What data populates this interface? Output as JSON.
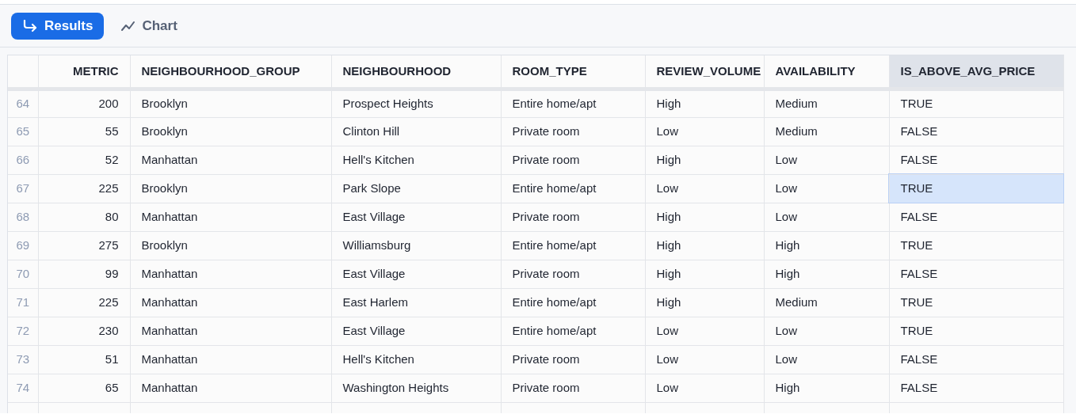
{
  "tabs": [
    {
      "label": "Results",
      "kind": "results",
      "selected": true
    },
    {
      "label": "Chart",
      "kind": "chart",
      "selected": false
    }
  ],
  "table": {
    "columns": [
      {
        "label": "METRIC",
        "numeric": true,
        "selected": false
      },
      {
        "label": "NEIGHBOURHOOD_GROUP",
        "numeric": false,
        "selected": false
      },
      {
        "label": "NEIGHBOURHOOD",
        "numeric": false,
        "selected": false
      },
      {
        "label": "ROOM_TYPE",
        "numeric": false,
        "selected": false
      },
      {
        "label": "REVIEW_VOLUME",
        "numeric": false,
        "selected": false
      },
      {
        "label": "AVAILABILITY",
        "numeric": false,
        "selected": false
      },
      {
        "label": "IS_ABOVE_AVG_PRICE",
        "numeric": false,
        "selected": true
      }
    ],
    "rows": [
      {
        "number": "64",
        "cells": [
          {
            "text": "200",
            "selected": false
          },
          {
            "text": "Brooklyn",
            "selected": false
          },
          {
            "text": "Prospect Heights",
            "selected": false
          },
          {
            "text": "Entire home/apt",
            "selected": false
          },
          {
            "text": "High",
            "selected": false
          },
          {
            "text": "Medium",
            "selected": false
          },
          {
            "text": "TRUE",
            "selected": false
          }
        ]
      },
      {
        "number": "65",
        "cells": [
          {
            "text": "55",
            "selected": false
          },
          {
            "text": "Brooklyn",
            "selected": false
          },
          {
            "text": "Clinton Hill",
            "selected": false
          },
          {
            "text": "Private room",
            "selected": false
          },
          {
            "text": "Low",
            "selected": false
          },
          {
            "text": "Medium",
            "selected": false
          },
          {
            "text": "FALSE",
            "selected": false
          }
        ]
      },
      {
        "number": "66",
        "cells": [
          {
            "text": "52",
            "selected": false
          },
          {
            "text": "Manhattan",
            "selected": false
          },
          {
            "text": "Hell's Kitchen",
            "selected": false
          },
          {
            "text": "Private room",
            "selected": false
          },
          {
            "text": "High",
            "selected": false
          },
          {
            "text": "Low",
            "selected": false
          },
          {
            "text": "FALSE",
            "selected": false
          }
        ]
      },
      {
        "number": "67",
        "cells": [
          {
            "text": "225",
            "selected": false
          },
          {
            "text": "Brooklyn",
            "selected": false
          },
          {
            "text": "Park Slope",
            "selected": false
          },
          {
            "text": "Entire home/apt",
            "selected": false
          },
          {
            "text": "Low",
            "selected": false
          },
          {
            "text": "Low",
            "selected": false
          },
          {
            "text": "TRUE",
            "selected": true
          }
        ]
      },
      {
        "number": "68",
        "cells": [
          {
            "text": "80",
            "selected": false
          },
          {
            "text": "Manhattan",
            "selected": false
          },
          {
            "text": "East Village",
            "selected": false
          },
          {
            "text": "Private room",
            "selected": false
          },
          {
            "text": "High",
            "selected": false
          },
          {
            "text": "Low",
            "selected": false
          },
          {
            "text": "FALSE",
            "selected": false
          }
        ]
      },
      {
        "number": "69",
        "cells": [
          {
            "text": "275",
            "selected": false
          },
          {
            "text": "Brooklyn",
            "selected": false
          },
          {
            "text": "Williamsburg",
            "selected": false
          },
          {
            "text": "Entire home/apt",
            "selected": false
          },
          {
            "text": "High",
            "selected": false
          },
          {
            "text": "High",
            "selected": false
          },
          {
            "text": "TRUE",
            "selected": false
          }
        ]
      },
      {
        "number": "70",
        "cells": [
          {
            "text": "99",
            "selected": false
          },
          {
            "text": "Manhattan",
            "selected": false
          },
          {
            "text": "East Village",
            "selected": false
          },
          {
            "text": "Private room",
            "selected": false
          },
          {
            "text": "High",
            "selected": false
          },
          {
            "text": "High",
            "selected": false
          },
          {
            "text": "FALSE",
            "selected": false
          }
        ]
      },
      {
        "number": "71",
        "cells": [
          {
            "text": "225",
            "selected": false
          },
          {
            "text": "Manhattan",
            "selected": false
          },
          {
            "text": "East Harlem",
            "selected": false
          },
          {
            "text": "Entire home/apt",
            "selected": false
          },
          {
            "text": "High",
            "selected": false
          },
          {
            "text": "Medium",
            "selected": false
          },
          {
            "text": "TRUE",
            "selected": false
          }
        ]
      },
      {
        "number": "72",
        "cells": [
          {
            "text": "230",
            "selected": false
          },
          {
            "text": "Manhattan",
            "selected": false
          },
          {
            "text": "East Village",
            "selected": false
          },
          {
            "text": "Entire home/apt",
            "selected": false
          },
          {
            "text": "Low",
            "selected": false
          },
          {
            "text": "Low",
            "selected": false
          },
          {
            "text": "TRUE",
            "selected": false
          }
        ]
      },
      {
        "number": "73",
        "cells": [
          {
            "text": "51",
            "selected": false
          },
          {
            "text": "Manhattan",
            "selected": false
          },
          {
            "text": "Hell's Kitchen",
            "selected": false
          },
          {
            "text": "Private room",
            "selected": false
          },
          {
            "text": "Low",
            "selected": false
          },
          {
            "text": "Low",
            "selected": false
          },
          {
            "text": "FALSE",
            "selected": false
          }
        ]
      },
      {
        "number": "74",
        "cells": [
          {
            "text": "65",
            "selected": false
          },
          {
            "text": "Manhattan",
            "selected": false
          },
          {
            "text": "Washington Heights",
            "selected": false
          },
          {
            "text": "Private room",
            "selected": false
          },
          {
            "text": "Low",
            "selected": false
          },
          {
            "text": "High",
            "selected": false
          },
          {
            "text": "FALSE",
            "selected": false
          }
        ]
      }
    ]
  }
}
